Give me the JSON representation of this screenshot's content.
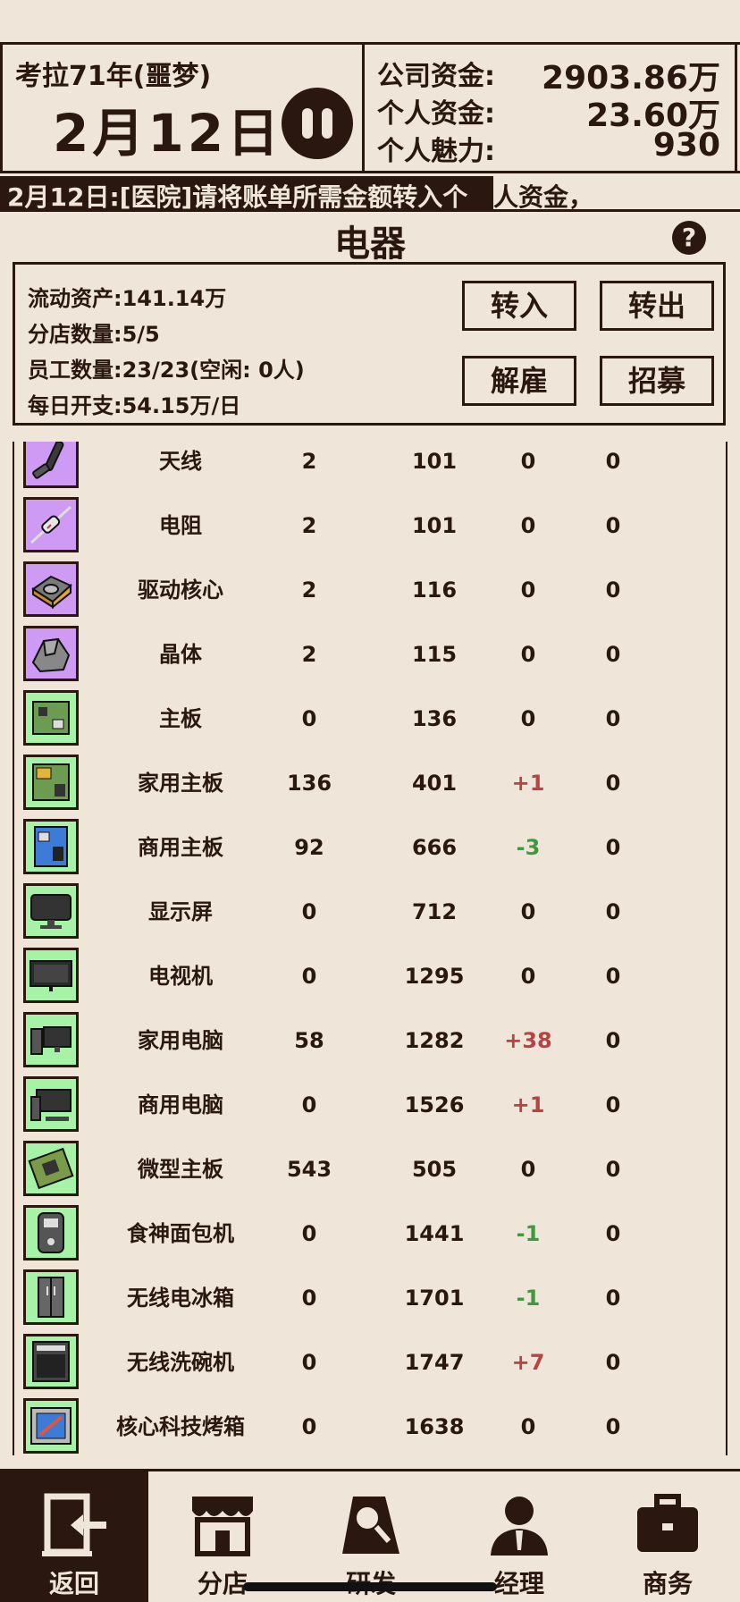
{
  "header": {
    "era": "考拉71年(噩梦)",
    "date": "2月12日",
    "company_funds_label": "公司资金:",
    "company_funds_value": "2903.86万",
    "personal_funds_label": "个人资金:",
    "personal_funds_value": "23.60万",
    "charm_label": "个人魅力:",
    "charm_value": "930"
  },
  "ticker": {
    "text_dark": "2月12日:[医院]请将账单所需金额转入个",
    "text_light": "人资金，"
  },
  "section": {
    "title": "电器"
  },
  "info": {
    "liquid_assets": "流动资产:141.14万",
    "branch_count": "分店数量:5/5",
    "employee_count": "员工数量:23/23(空闲: 0人)",
    "daily_cost": "每日开支:54.15万/日",
    "transfer_in": "转入",
    "transfer_out": "转出",
    "dismiss": "解雇",
    "recruit": "招募"
  },
  "items": [
    {
      "icon": "antenna-icon",
      "bg": "purple",
      "name": "天线",
      "a": "2",
      "b": "101",
      "c": "0",
      "c_type": "zero",
      "d": "0"
    },
    {
      "icon": "resistor-icon",
      "bg": "purple",
      "name": "电阻",
      "a": "2",
      "b": "101",
      "c": "0",
      "c_type": "zero",
      "d": "0"
    },
    {
      "icon": "drive-core-icon",
      "bg": "purple",
      "name": "驱动核心",
      "a": "2",
      "b": "116",
      "c": "0",
      "c_type": "zero",
      "d": "0"
    },
    {
      "icon": "crystal-icon",
      "bg": "purple",
      "name": "晶体",
      "a": "2",
      "b": "115",
      "c": "0",
      "c_type": "zero",
      "d": "0"
    },
    {
      "icon": "motherboard-icon",
      "bg": "green",
      "name": "主板",
      "a": "0",
      "b": "136",
      "c": "0",
      "c_type": "zero",
      "d": "0"
    },
    {
      "icon": "home-motherboard-icon",
      "bg": "green",
      "name": "家用主板",
      "a": "136",
      "b": "401",
      "c": "+1",
      "c_type": "pos",
      "d": "0"
    },
    {
      "icon": "business-motherboard-icon",
      "bg": "green",
      "name": "商用主板",
      "a": "92",
      "b": "666",
      "c": "-3",
      "c_type": "neg",
      "d": "0"
    },
    {
      "icon": "monitor-icon",
      "bg": "green",
      "name": "显示屏",
      "a": "0",
      "b": "712",
      "c": "0",
      "c_type": "zero",
      "d": "0"
    },
    {
      "icon": "tv-icon",
      "bg": "green",
      "name": "电视机",
      "a": "0",
      "b": "1295",
      "c": "0",
      "c_type": "zero",
      "d": "0"
    },
    {
      "icon": "home-pc-icon",
      "bg": "green",
      "name": "家用电脑",
      "a": "58",
      "b": "1282",
      "c": "+38",
      "c_type": "pos",
      "d": "0"
    },
    {
      "icon": "business-pc-icon",
      "bg": "green",
      "name": "商用电脑",
      "a": "0",
      "b": "1526",
      "c": "+1",
      "c_type": "pos",
      "d": "0"
    },
    {
      "icon": "micro-motherboard-icon",
      "bg": "green",
      "name": "微型主板",
      "a": "543",
      "b": "505",
      "c": "0",
      "c_type": "zero",
      "d": "0"
    },
    {
      "icon": "bread-maker-icon",
      "bg": "green",
      "name": "食神面包机",
      "a": "0",
      "b": "1441",
      "c": "-1",
      "c_type": "neg",
      "d": "0"
    },
    {
      "icon": "fridge-icon",
      "bg": "green",
      "name": "无线电冰箱",
      "a": "0",
      "b": "1701",
      "c": "-1",
      "c_type": "neg",
      "d": "0"
    },
    {
      "icon": "dishwasher-icon",
      "bg": "green",
      "name": "无线洗碗机",
      "a": "0",
      "b": "1747",
      "c": "+7",
      "c_type": "pos",
      "d": "0"
    },
    {
      "icon": "oven-icon",
      "bg": "green",
      "name": "核心科技烤箱",
      "a": "0",
      "b": "1638",
      "c": "0",
      "c_type": "zero",
      "d": "0"
    }
  ],
  "nav": [
    {
      "label": "返回",
      "icon": "exit-door-icon",
      "active": true
    },
    {
      "label": "分店",
      "icon": "shop-icon",
      "active": false
    },
    {
      "label": "研发",
      "icon": "research-icon",
      "active": false
    },
    {
      "label": "经理",
      "icon": "manager-icon",
      "active": false
    },
    {
      "label": "商务",
      "icon": "briefcase-icon",
      "active": false
    }
  ]
}
